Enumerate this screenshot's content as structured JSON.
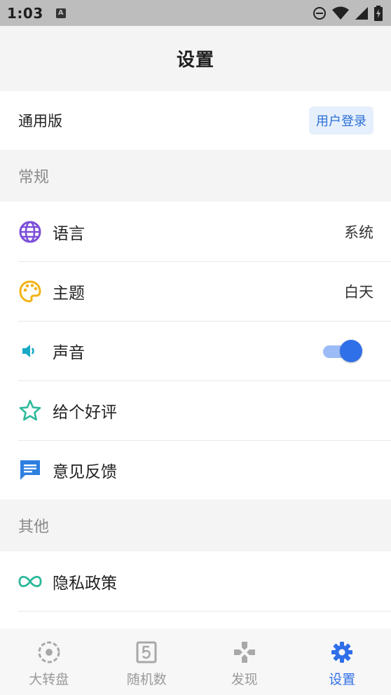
{
  "status_bar": {
    "time": "1:03",
    "notif_letter": "A"
  },
  "header": {
    "title": "设置"
  },
  "account": {
    "label": "通用版",
    "login_label": "用户登录"
  },
  "sections": {
    "general": "常规",
    "other": "其他"
  },
  "general_items": {
    "language": {
      "label": "语言",
      "value": "系统",
      "icon": "globe-icon"
    },
    "theme": {
      "label": "主题",
      "value": "白天",
      "icon": "palette-icon"
    },
    "sound": {
      "label": "声音",
      "icon": "speaker-icon",
      "enabled": true
    },
    "rate": {
      "label": "给个好评",
      "icon": "star-icon"
    },
    "feedback": {
      "label": "意见反馈",
      "icon": "message-icon"
    }
  },
  "other_items": {
    "privacy": {
      "label": "隐私政策",
      "icon": "infinity-icon"
    }
  },
  "bottom_nav": [
    {
      "label": "大转盘",
      "icon": "wheel-icon",
      "active": false
    },
    {
      "label": "随机数",
      "icon": "dice-five-icon",
      "active": false
    },
    {
      "label": "发现",
      "icon": "gamepad-icon",
      "active": false
    },
    {
      "label": "设置",
      "icon": "gear-icon",
      "active": true
    }
  ],
  "colors": {
    "accent": "#2f6fe8",
    "globe": "#7b4fd9",
    "palette": "#f2b316",
    "speaker": "#17a9c7",
    "star": "#2bb99a",
    "message": "#2d7fe0",
    "infinity": "#2bb99a"
  }
}
